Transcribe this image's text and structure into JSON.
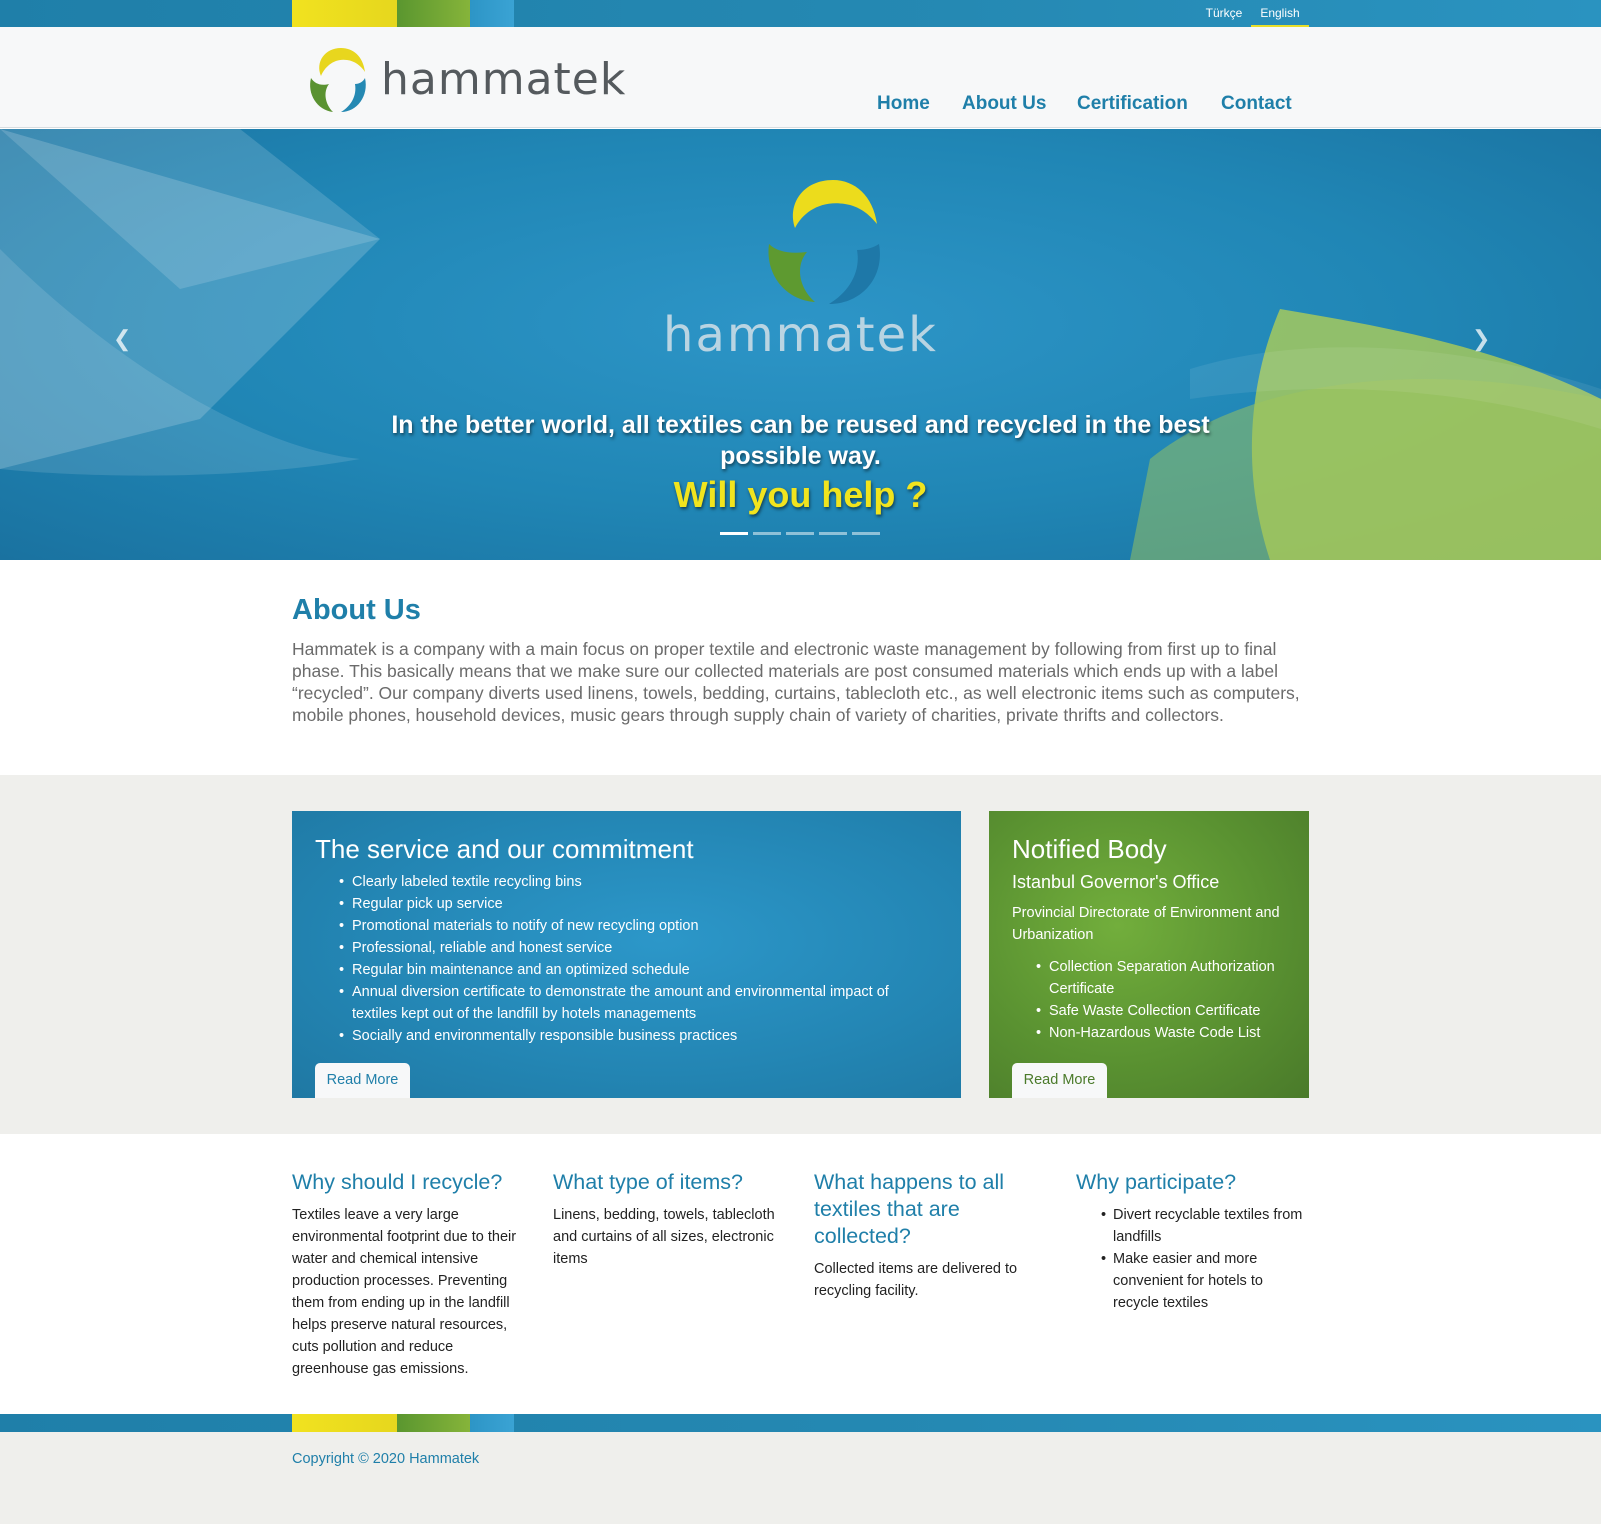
{
  "colors": {
    "brand_blue": "#1f7fa9",
    "brand_green": "#5a9231",
    "brand_yellow": "#f1e41e",
    "grey_band": "#efefec"
  },
  "top_bar": {
    "languages": [
      "Türkçe",
      "English"
    ],
    "active_language": "English"
  },
  "header": {
    "logo_text": "hammatek",
    "nav": [
      "Home",
      "About Us",
      "Certification",
      "Contact"
    ]
  },
  "hero": {
    "brand": "hammatek",
    "tagline": "In the better world, all textiles can be reused and recycled in the best possible way.",
    "cta": "Will you help ?",
    "prev_icon": "chevron-left-icon",
    "next_icon": "chevron-right-icon",
    "slide_count": 5,
    "active_slide": 1
  },
  "about": {
    "title": "About Us",
    "text": "Hammatek is a company with a main focus on proper textile and electronic waste management by following from first up to final phase. This basically means that we make sure our collected materials are post consumed materials which ends up with a label “recycled”. Our company diverts used linens, towels, bedding, curtains, tablecloth etc., as well electronic items such as computers, mobile phones, household devices, music gears through supply chain of variety of charities, private thrifts and collectors."
  },
  "service_card": {
    "title": "The service and our commitment",
    "items": [
      "Clearly labeled textile recycling bins",
      "Regular pick up service",
      "Promotional materials to notify of new recycling option",
      "Professional, reliable and honest service",
      "Regular bin maintenance and an optimized schedule",
      "Annual diversion certificate to demonstrate the amount and environmental impact of textiles kept out of the landfill by hotels managements",
      "Socially and environmentally responsible business practices"
    ],
    "button": "Read More"
  },
  "notified_card": {
    "title": "Notified Body",
    "subtitle": "Istanbul Governor's Office",
    "description": "Provincial Directorate of Environment and Urbanization",
    "items": [
      "Collection Separation Authorization Certificate",
      "Safe Waste Collection Certificate",
      "Non-Hazardous Waste Code List"
    ],
    "button": "Read More"
  },
  "columns": [
    {
      "title": "Why should I recycle?",
      "text": "Textiles leave a very large environmental footprint due to their water and chemical intensive production processes. Preventing them from ending up in the landfill helps preserve natural resources, cuts pollution and reduce greenhouse gas emissions."
    },
    {
      "title": "What type of items?",
      "text": "Linens, bedding, towels, tablecloth and curtains of all sizes, electronic items"
    },
    {
      "title": "What happens to all textiles that are collected?",
      "text": "Collected items are delivered to recycling facility."
    },
    {
      "title": "Why participate?",
      "items": [
        "Divert recyclable textiles from landfills",
        "Make easier and more convenient for hotels to recycle textiles"
      ]
    }
  ],
  "footer": {
    "copyright": "Copyright © 2020 Hammatek"
  }
}
